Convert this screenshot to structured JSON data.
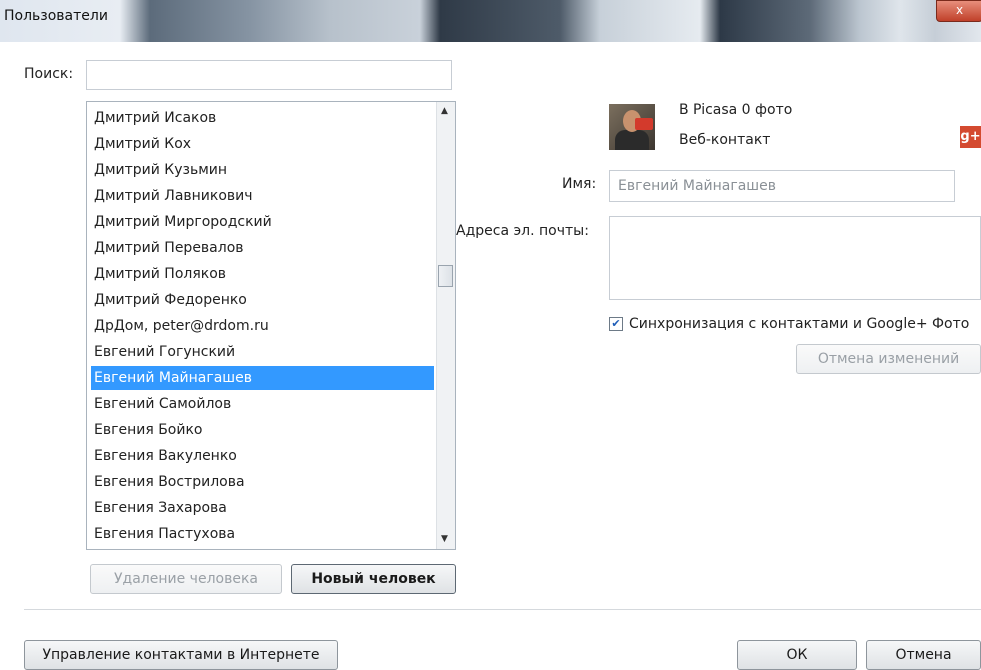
{
  "window": {
    "title": "Пользователи",
    "close_glyph": "x"
  },
  "search": {
    "label": "Поиск:",
    "value": ""
  },
  "contacts": [
    "Дмитрий Исаков",
    "Дмитрий Кох",
    "Дмитрий Кузьмин",
    "Дмитрий Лавникович",
    "Дмитрий Миргородский",
    "Дмитрий Перевалов",
    "Дмитрий Поляков",
    "Дмитрий Федоренко",
    "ДрДом, peter@drdom.ru",
    "Евгений Гогунский",
    "Евгений Майнагашев",
    "Евгений Самойлов",
    "Евгения Бойко",
    "Евгения Вакуленко",
    "Евгения Вострилова",
    "Евгения Захарова",
    "Евгения Пастухова"
  ],
  "selected_index": 10,
  "list_buttons": {
    "delete": "Удаление человека",
    "new": "Новый человек"
  },
  "detail": {
    "photo_count": "В Picasa 0 фото",
    "contact_type": "Веб-контакт",
    "name_label": "Имя:",
    "name_value": "Евгений Майнагашев",
    "email_label": "Адреса эл. почты:",
    "sync_label": "Синхронизация с контактами и Google+ Фото",
    "sync_checked": true,
    "revert_button": "Отмена изменений",
    "gplus_glyph": "g+"
  },
  "footer": {
    "manage_button": "Управление контактами в Интернете",
    "ok_button": "ОК",
    "cancel_button": "Отмена"
  }
}
